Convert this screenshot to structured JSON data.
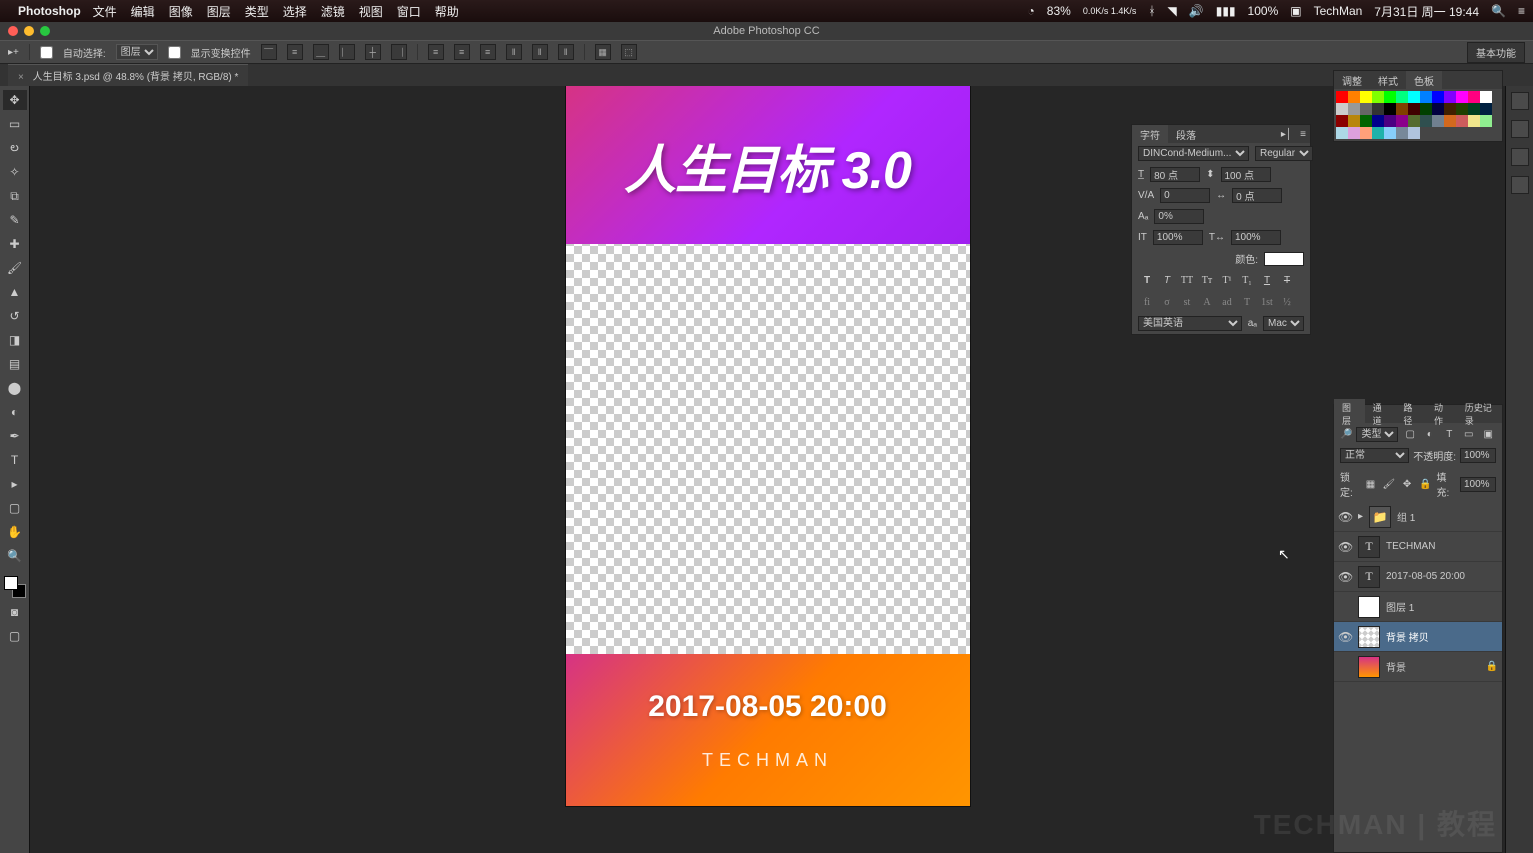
{
  "menubar": {
    "app": "Photoshop",
    "items": [
      "文件",
      "编辑",
      "图像",
      "图层",
      "类型",
      "选择",
      "滤镜",
      "视图",
      "窗口",
      "帮助"
    ],
    "right": {
      "cpu": "83%",
      "net": "0.0K/s 1.4K/s",
      "battery": "100%",
      "user": "TechMan",
      "date": "7月31日 周一 19:44"
    }
  },
  "window_title": "Adobe Photoshop CC",
  "options": {
    "auto_select": "自动选择:",
    "auto_select_val": "图层",
    "show_transform": "显示变换控件",
    "workspace_preset": "基本功能"
  },
  "document_tab": "人生目标 3.psd @ 48.8% (背景 拷贝, RGB/8) *",
  "canvas": {
    "title": "人生目标 3.0",
    "date": "2017-08-05 20:00",
    "brand": "TECHMAN"
  },
  "char_panel": {
    "tabs": [
      "字符",
      "段落"
    ],
    "font": "DINCond-Medium...",
    "style": "Regular",
    "size": "80 点",
    "leading": "100 点",
    "tracking_va": "0",
    "tracking": "0 点",
    "baseline": "0%",
    "vscale": "100%",
    "hscale": "100%",
    "color_label": "颜色:",
    "lang": "美国英语",
    "aa": "Mac"
  },
  "swatch_panel": {
    "tabs": [
      "调整",
      "样式",
      "色板"
    ]
  },
  "layers_panel": {
    "tabs": [
      "图层",
      "通道",
      "路径",
      "动作",
      "历史记录"
    ],
    "filter_label": "类型",
    "blend": "正常",
    "opacity_label": "不透明度:",
    "opacity": "100%",
    "lock_label": "锁定:",
    "fill_label": "填充:",
    "fill": "100%",
    "layers": [
      {
        "vis": true,
        "type": "group",
        "name": "组 1"
      },
      {
        "vis": true,
        "type": "text",
        "name": "TECHMAN"
      },
      {
        "vis": true,
        "type": "text",
        "name": "2017-08-05 20:00"
      },
      {
        "vis": false,
        "type": "white",
        "name": "图层 1"
      },
      {
        "vis": true,
        "type": "check",
        "name": "背景 拷贝",
        "selected": true
      },
      {
        "vis": false,
        "type": "grad",
        "name": "背景",
        "locked": true
      }
    ]
  },
  "watermark": "TECHMAN | 教程",
  "swatch_colors": [
    "#ff0000",
    "#ff8000",
    "#ffff00",
    "#80ff00",
    "#00ff00",
    "#00ff80",
    "#00ffff",
    "#0080ff",
    "#0000ff",
    "#8000ff",
    "#ff00ff",
    "#ff0080",
    "#ffffff",
    "#cccccc",
    "#999999",
    "#666666",
    "#333333",
    "#000000",
    "#804000",
    "#400000",
    "#004000",
    "#000040",
    "#402000",
    "#204000",
    "#004020",
    "#002040",
    "#8b0000",
    "#b8860b",
    "#006400",
    "#00008b",
    "#4b0082",
    "#8b008b",
    "#556b2f",
    "#2f4f4f",
    "#708090",
    "#d2691e",
    "#cd5c5c",
    "#f0e68c",
    "#90ee90",
    "#add8e6",
    "#dda0dd",
    "#ffa07a",
    "#20b2aa",
    "#87cefa",
    "#778899",
    "#b0c4de"
  ]
}
